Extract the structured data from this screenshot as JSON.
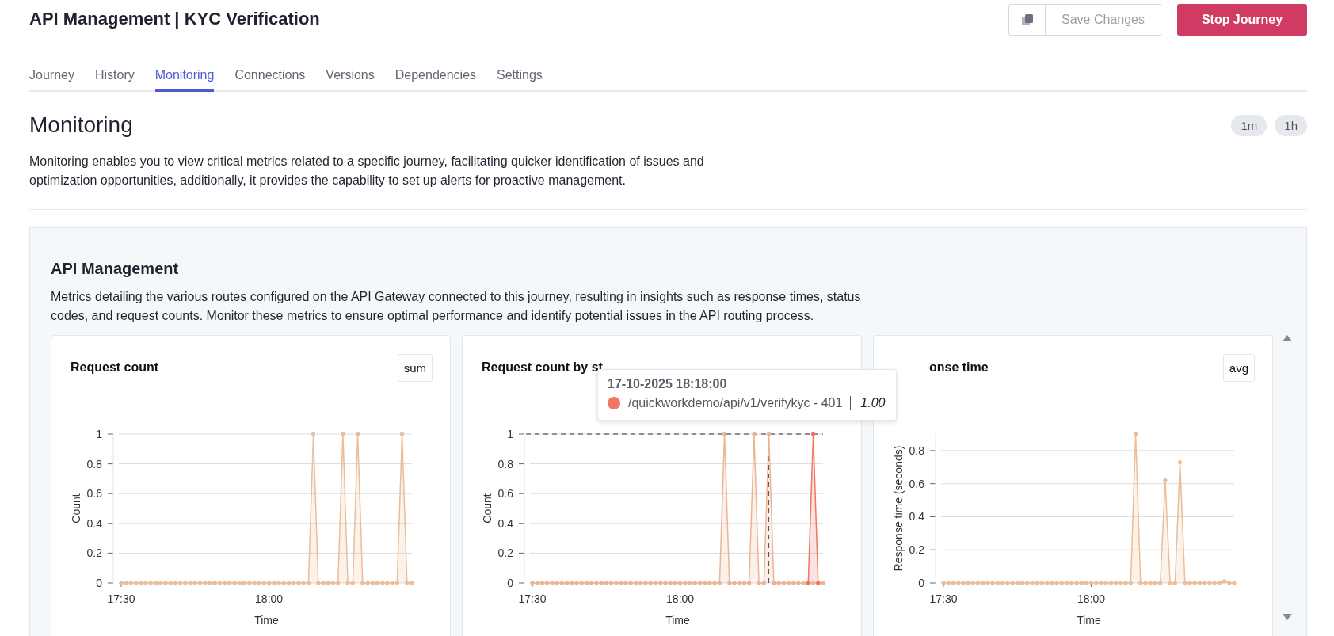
{
  "header": {
    "title": "API Management | KYC Verification",
    "buttons": [
      {
        "kind": "copy"
      },
      {
        "kind": "save",
        "label": "Save Changes",
        "disabled": true
      },
      {
        "kind": "stop",
        "label": "Stop Journey"
      }
    ]
  },
  "tabs": [
    {
      "label": "Journey",
      "selected": false
    },
    {
      "label": "History",
      "selected": false
    },
    {
      "label": "Monitoring",
      "selected": true
    },
    {
      "label": "Connections",
      "selected": false
    },
    {
      "label": "Versions",
      "selected": false
    },
    {
      "label": "Dependencies",
      "selected": false
    },
    {
      "label": "Settings",
      "selected": false
    }
  ],
  "monitoring": {
    "heading": "Monitoring",
    "ranges": [
      {
        "label": "1m"
      },
      {
        "label": "1h"
      }
    ],
    "description": "Monitoring enables you to view critical metrics related to a specific journey, facilitating quicker identification of issues and optimization opportunities, additionally, it provides the capability to set up alerts for proactive management."
  },
  "section": {
    "title": "API Management",
    "description": "Metrics detailing the various routes configured on the API Gateway connected to this journey, resulting in insights such as response times, status codes, and request counts. Monitor these metrics to ensure optimal performance and identify potential issues in the API routing process.",
    "cards": [
      {
        "title": "Request count",
        "aggregation": "sum",
        "chart_data": {
          "type": "area",
          "grid": true,
          "xlabel": "Time",
          "ylabel": "Count",
          "categories": [
            "17:30",
            null,
            null,
            null,
            null,
            null,
            null,
            null,
            null,
            null,
            null,
            null,
            null,
            null,
            null,
            null,
            null,
            null,
            null,
            null,
            null,
            null,
            null,
            null,
            null,
            null,
            null,
            null,
            null,
            null,
            "18:00",
            null,
            null,
            null,
            null,
            null,
            null,
            null,
            null,
            null,
            null,
            null,
            null,
            null,
            null,
            null,
            null,
            null,
            null,
            null,
            null,
            null,
            null,
            null,
            null,
            null,
            null,
            null,
            null,
            null
          ],
          "ylim": [
            0,
            1
          ],
          "yticks": [
            0,
            0.2,
            0.4,
            0.6,
            0.8,
            1
          ],
          "series": [
            {
              "color": "#ebbd98",
              "values": [
                0,
                0,
                0,
                0,
                0,
                0,
                0,
                0,
                0,
                0,
                0,
                0,
                0,
                0,
                0,
                0,
                0,
                0,
                0,
                0,
                0,
                0,
                0,
                0,
                0,
                0,
                0,
                0,
                0,
                0,
                0,
                0,
                0,
                0,
                0,
                0,
                0,
                0,
                0,
                1,
                0,
                0,
                0,
                0,
                0,
                1,
                0,
                0,
                1,
                0,
                0,
                0,
                0,
                0,
                0,
                0,
                0,
                1,
                0,
                0
              ]
            }
          ]
        }
      },
      {
        "title": "Request count by st",
        "tooltip": {
          "time": "17-10-2025 18:18:00",
          "value": "1.00"
        },
        "chart_data": {
          "type": "area",
          "grid": true,
          "xlabel": "Time",
          "ylabel": "Count",
          "categories": [
            "17:30",
            null,
            null,
            null,
            null,
            null,
            null,
            null,
            null,
            null,
            null,
            null,
            null,
            null,
            null,
            null,
            null,
            null,
            null,
            null,
            null,
            null,
            null,
            null,
            null,
            null,
            null,
            null,
            null,
            null,
            "18:00",
            null,
            null,
            null,
            null,
            null,
            null,
            null,
            null,
            null,
            null,
            null,
            null,
            null,
            null,
            null,
            null,
            null,
            null,
            null,
            null,
            null,
            null,
            null,
            null,
            null,
            null,
            null,
            null,
            null
          ],
          "ylim": [
            0,
            1
          ],
          "yticks": [
            0,
            0.2,
            0.4,
            0.6,
            0.8,
            1
          ],
          "ref_lines": [
            {
              "axis": "y",
              "value": 1
            }
          ],
          "series": [
            {
              "color": "#ebb594",
              "values": [
                0,
                0,
                0,
                0,
                0,
                0,
                0,
                0,
                0,
                0,
                0,
                0,
                0,
                0,
                0,
                0,
                0,
                0,
                0,
                0,
                0,
                0,
                0,
                0,
                0,
                0,
                0,
                0,
                0,
                0,
                0,
                0,
                0,
                0,
                0,
                0,
                0,
                0,
                0,
                1,
                0,
                0,
                0,
                0,
                0,
                1,
                0,
                0,
                1,
                0,
                0,
                0,
                0,
                0,
                0,
                0,
                0,
                0,
                0,
                0
              ]
            },
            {
              "name": "/quickworkdemo/api/v1/verifykyc - 401",
              "color": "#f07563",
              "values": [
                null,
                null,
                null,
                null,
                null,
                null,
                null,
                null,
                null,
                null,
                null,
                null,
                null,
                null,
                null,
                null,
                null,
                null,
                null,
                null,
                null,
                null,
                null,
                null,
                null,
                null,
                null,
                null,
                null,
                null,
                null,
                null,
                null,
                null,
                null,
                null,
                null,
                null,
                null,
                null,
                null,
                null,
                null,
                null,
                null,
                null,
                null,
                null,
                null,
                null,
                null,
                null,
                null,
                null,
                null,
                null,
                0,
                1,
                0,
                null
              ]
            }
          ]
        }
      },
      {
        "title": "onse time",
        "aggregation": "avg",
        "chart_data": {
          "type": "area",
          "grid": true,
          "xlabel": "Time",
          "ylabel": "Response time (seconds)",
          "categories": [
            "17:30",
            null,
            null,
            null,
            null,
            null,
            null,
            null,
            null,
            null,
            null,
            null,
            null,
            null,
            null,
            null,
            null,
            null,
            null,
            null,
            null,
            null,
            null,
            null,
            null,
            null,
            null,
            null,
            null,
            null,
            "18:00",
            null,
            null,
            null,
            null,
            null,
            null,
            null,
            null,
            null,
            null,
            null,
            null,
            null,
            null,
            null,
            null,
            null,
            null,
            null,
            null,
            null,
            null,
            null,
            null,
            null,
            null,
            null,
            null,
            null
          ],
          "ylim": [
            0,
            0.9
          ],
          "yticks": [
            0,
            0.2,
            0.4,
            0.6,
            0.8
          ],
          "series": [
            {
              "color": "#ebbd98",
              "values": [
                0,
                0,
                0,
                0,
                0,
                0,
                0,
                0,
                0,
                0,
                0,
                0,
                0,
                0,
                0,
                0,
                0,
                0,
                0,
                0,
                0,
                0,
                0,
                0,
                0,
                0,
                0,
                0,
                0,
                0,
                0,
                0,
                0,
                0,
                0,
                0,
                0,
                0,
                0,
                0.9,
                0,
                0,
                0,
                0,
                0,
                0.62,
                0,
                0,
                0.73,
                0,
                0,
                0,
                0,
                0,
                0,
                0,
                0,
                0.01,
                0,
                0
              ]
            }
          ]
        }
      }
    ]
  }
}
